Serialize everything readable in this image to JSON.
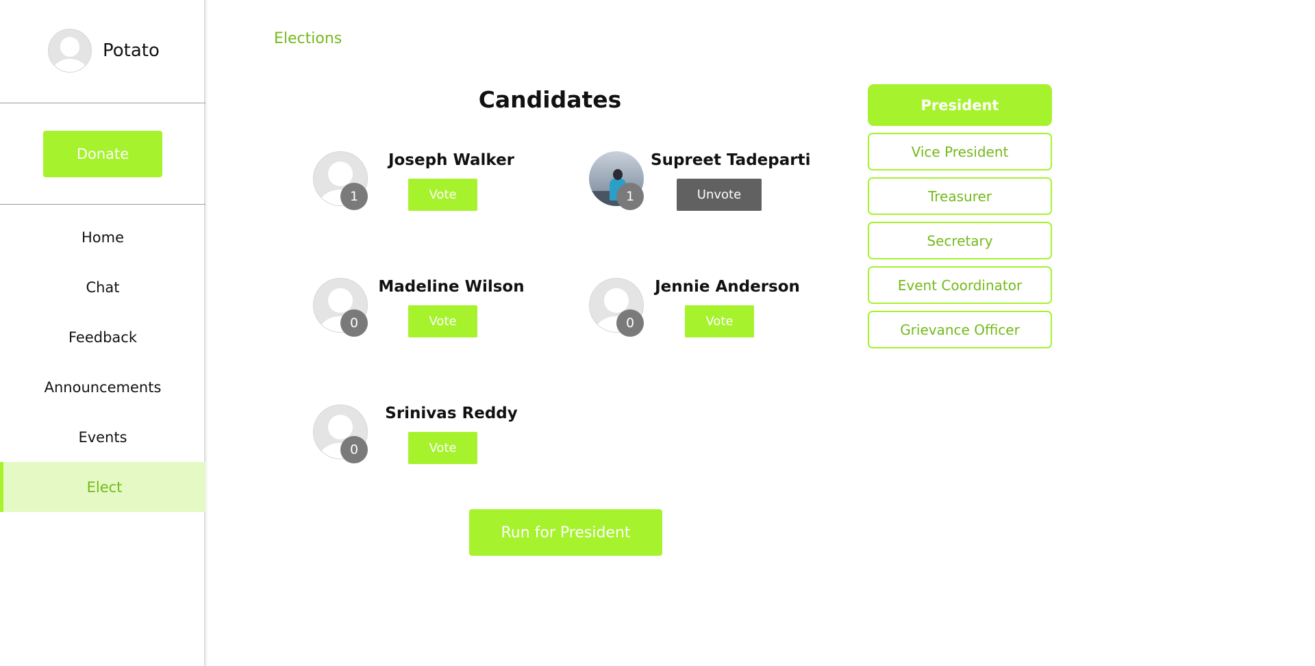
{
  "user": {
    "name": "Potato"
  },
  "sidebar": {
    "donate_label": "Donate",
    "items": [
      {
        "label": "Home"
      },
      {
        "label": "Chat"
      },
      {
        "label": "Feedback"
      },
      {
        "label": "Announcements"
      },
      {
        "label": "Events"
      },
      {
        "label": "Elect",
        "active": true
      }
    ]
  },
  "main": {
    "breadcrumb": "Elections",
    "title": "Candidates",
    "candidates": [
      {
        "name": "Joseph Walker",
        "votes": "1",
        "action": "Vote",
        "avatar": "default"
      },
      {
        "name": "Supreet Tadeparti",
        "votes": "1",
        "action": "Unvote",
        "avatar": "photo"
      },
      {
        "name": "Madeline Wilson",
        "votes": "0",
        "action": "Vote",
        "avatar": "default"
      },
      {
        "name": "Jennie Anderson",
        "votes": "0",
        "action": "Vote",
        "avatar": "default"
      },
      {
        "name": "Srinivas Reddy",
        "votes": "0",
        "action": "Vote",
        "avatar": "default"
      }
    ],
    "run_label": "Run for President"
  },
  "roles": [
    {
      "label": "President",
      "active": true
    },
    {
      "label": "Vice President"
    },
    {
      "label": "Treasurer"
    },
    {
      "label": "Secretary"
    },
    {
      "label": "Event Coordinator"
    },
    {
      "label": "Grievance Officer"
    }
  ],
  "colors": {
    "accent": "#a6f22c",
    "accent_text": "#74b91a",
    "active_bg": "#e4f9c4",
    "unvote": "#616161",
    "badge": "#7a7a7a"
  }
}
